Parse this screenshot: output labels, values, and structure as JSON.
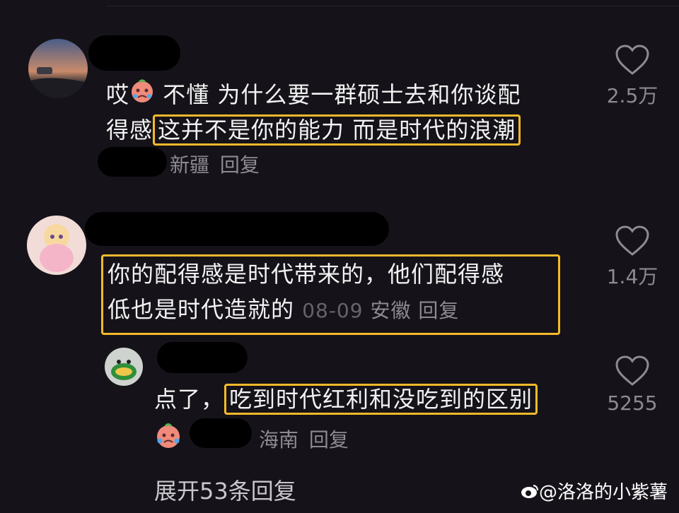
{
  "comments": [
    {
      "text_part1": "哎",
      "text_part2": " 不懂 为什么要一群硕士去和你谈配",
      "text_line2_prefix": "得感",
      "highlight": "这并不是你的能力 而是时代的浪潮",
      "location": "新疆",
      "reply_label": "回复",
      "likes": "2.5万"
    },
    {
      "line1": "你的配得感是时代带来的，他们配得感",
      "line2": "低也是时代造就的",
      "date": "08-09",
      "location": "安徽",
      "reply_label": "回复",
      "likes": "1.4万"
    }
  ],
  "reply": {
    "prefix": "点了，",
    "highlight": "吃到时代红利和没吃到的区别",
    "location": "海南",
    "reply_label": "回复",
    "likes": "5255"
  },
  "expand_label": "展开53条回复",
  "watermark": "@洛洛的小紫薯",
  "colors": {
    "background": "#151319",
    "highlight_border": "#f5b92a",
    "muted_text": "#8d8a92"
  },
  "icons": [
    "heart-outline-icon",
    "crying-emoji-icon",
    "weibo-logo-icon"
  ]
}
